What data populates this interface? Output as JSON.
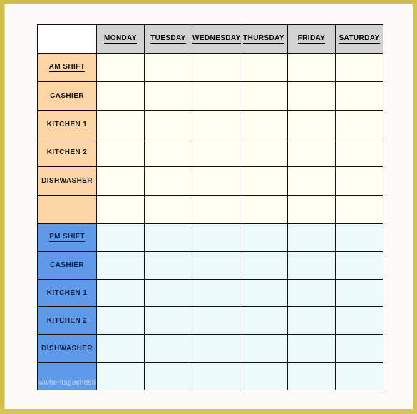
{
  "page": {
    "border_color": "#d2bf4a",
    "sheet_color": "#fdfafa"
  },
  "table": {
    "corner_label": "",
    "day_headers": [
      "MONDAY",
      "TUESDAY",
      "WEDNESDAY",
      "THURSDAY",
      "FRIDAY",
      "SATURDAY"
    ],
    "am_section": {
      "header_color": "#fbd5a5",
      "cell_color": "#fffff2",
      "rows": [
        {
          "label": "AM SHIFT",
          "is_title": true,
          "cells": [
            "",
            "",
            "",
            "",
            "",
            ""
          ]
        },
        {
          "label": "CASHIER",
          "is_title": false,
          "cells": [
            "",
            "",
            "",
            "",
            "",
            ""
          ]
        },
        {
          "label": "KITCHEN 1",
          "is_title": false,
          "cells": [
            "",
            "",
            "",
            "",
            "",
            ""
          ]
        },
        {
          "label": "KITCHEN 2",
          "is_title": false,
          "cells": [
            "",
            "",
            "",
            "",
            "",
            ""
          ]
        },
        {
          "label": "DISHWASHER",
          "is_title": false,
          "cells": [
            "",
            "",
            "",
            "",
            "",
            ""
          ]
        },
        {
          "label": "",
          "is_title": false,
          "cells": [
            "",
            "",
            "",
            "",
            "",
            ""
          ]
        }
      ]
    },
    "pm_section": {
      "header_color": "#5e9ae8",
      "cell_color": "#ecfafb",
      "rows": [
        {
          "label": "PM SHIFT",
          "is_title": true,
          "cells": [
            "",
            "",
            "",
            "",
            "",
            ""
          ]
        },
        {
          "label": "CASHIER",
          "is_title": false,
          "cells": [
            "",
            "",
            "",
            "",
            "",
            ""
          ]
        },
        {
          "label": "KITCHEN 1",
          "is_title": false,
          "cells": [
            "",
            "",
            "",
            "",
            "",
            ""
          ]
        },
        {
          "label": "KITCHEN 2",
          "is_title": false,
          "cells": [
            "",
            "",
            "",
            "",
            "",
            ""
          ]
        },
        {
          "label": "DISHWASHER",
          "is_title": false,
          "cells": [
            "",
            "",
            "",
            "",
            "",
            ""
          ]
        },
        {
          "label": "",
          "is_title": false,
          "cells": [
            "",
            "",
            "",
            "",
            "",
            ""
          ]
        }
      ]
    }
  },
  "watermark": {
    "text": "wwheritagechristi"
  }
}
